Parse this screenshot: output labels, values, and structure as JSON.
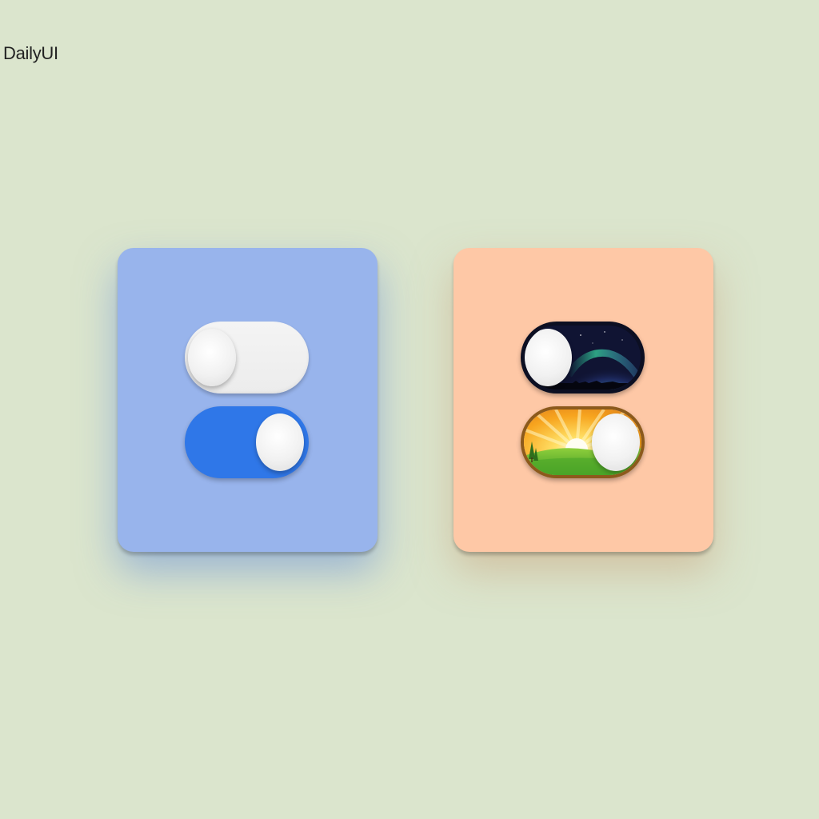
{
  "brand": {
    "label": "DailyUI"
  },
  "colors": {
    "background": "#dbe5cd",
    "card_blue": "#98b4ec",
    "card_peach": "#fec8a6",
    "toggle_on_blue": "#2f77e8",
    "toggle_off": "#ececec"
  },
  "cards": [
    {
      "theme": "blue",
      "toggles": [
        {
          "style": "plain",
          "state": "off"
        },
        {
          "style": "plain",
          "state": "on"
        }
      ]
    },
    {
      "theme": "peach",
      "toggles": [
        {
          "style": "night-aurora",
          "state": "off"
        },
        {
          "style": "day-sunrise",
          "state": "on"
        }
      ]
    }
  ]
}
